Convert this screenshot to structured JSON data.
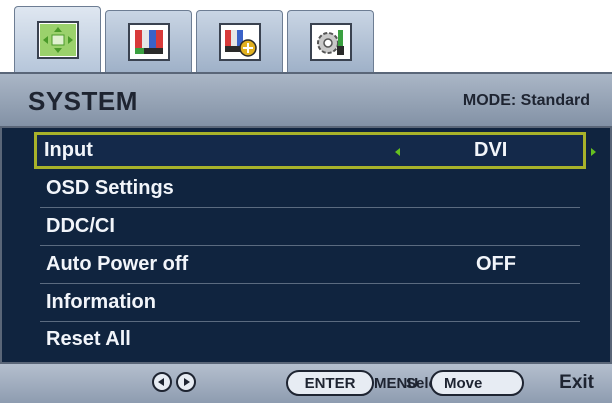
{
  "tabs": [
    {
      "icon": "picture-icon",
      "active": true
    },
    {
      "icon": "color-bars-icon",
      "active": false
    },
    {
      "icon": "picture-advanced-icon",
      "active": false
    },
    {
      "icon": "system-tools-icon",
      "active": false
    }
  ],
  "header": {
    "title": "SYSTEM",
    "mode": "MODE: Standard"
  },
  "menu": {
    "items": [
      {
        "label": "Input",
        "value": "DVI",
        "selected": true
      },
      {
        "label": "OSD Settings",
        "value": ""
      },
      {
        "label": "DDC/CI",
        "value": ""
      },
      {
        "label": "Auto Power off",
        "value": "OFF"
      },
      {
        "label": "Information",
        "value": ""
      },
      {
        "label": "Reset All",
        "value": ""
      }
    ]
  },
  "footer": {
    "enter_label": "ENTER",
    "select_label": "Select",
    "move_label": "Move",
    "menu_label": "MENU",
    "exit_label": "Exit"
  },
  "colors": {
    "panel": "#10243f",
    "highlight_border": "#a8b22a",
    "arrow": "#66c020",
    "header": "#9aa7b9"
  }
}
